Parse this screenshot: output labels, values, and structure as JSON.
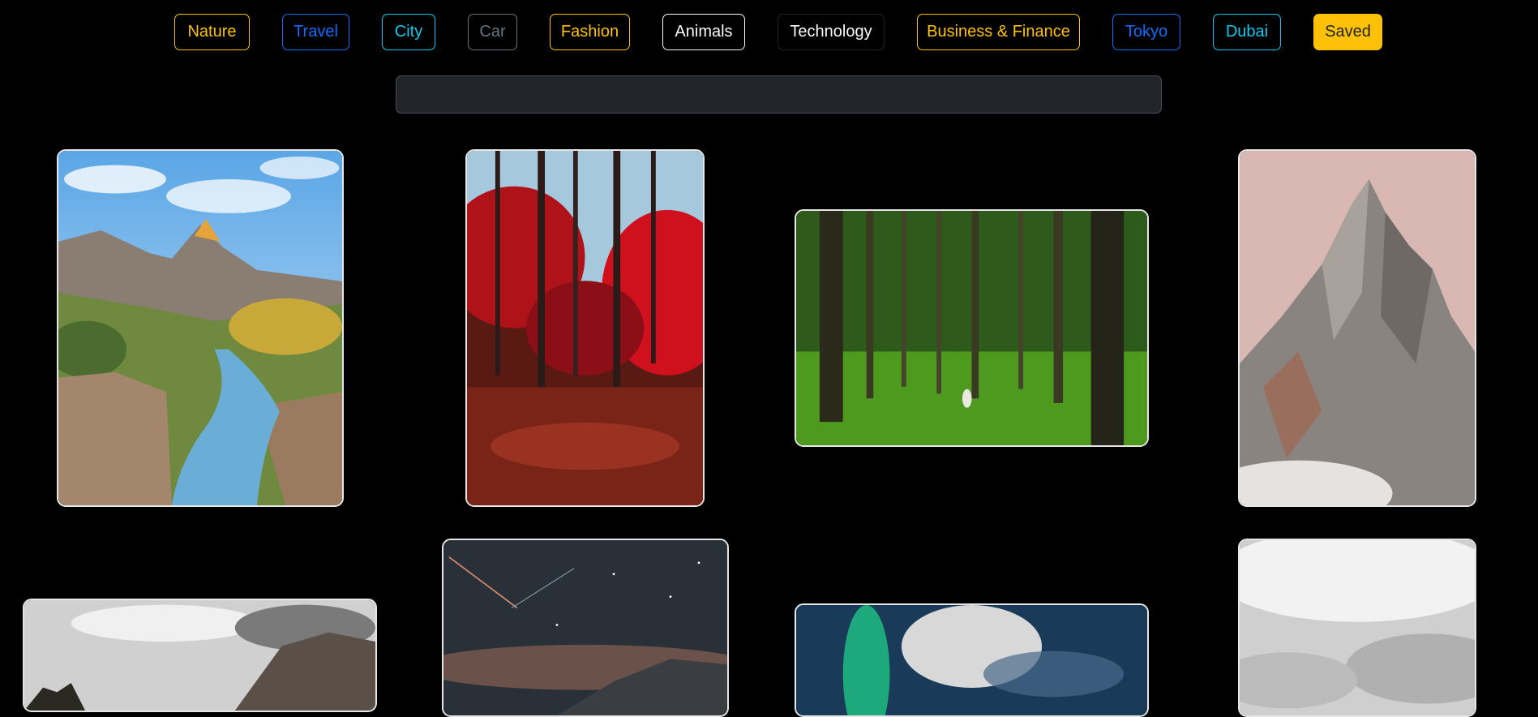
{
  "categories": [
    {
      "label": "Nature",
      "color": "#ffc107"
    },
    {
      "label": "Travel",
      "color": "#0d6efd"
    },
    {
      "label": "City",
      "color": "#0dcaf0"
    },
    {
      "label": "Car",
      "color": "#6c757d"
    },
    {
      "label": "Fashion",
      "color": "#ffc107"
    },
    {
      "label": "Animals",
      "color": "#f8f9fa"
    },
    {
      "label": "Technology",
      "color": "#212529"
    },
    {
      "label": "Business & Finance",
      "color": "#ffc107"
    },
    {
      "label": "Tokyo",
      "color": "#0d6efd"
    },
    {
      "label": "Dubai",
      "color": "#0dcaf0"
    }
  ],
  "saved": {
    "label": "Saved",
    "color": "#ffc107"
  },
  "search": {
    "value": "",
    "placeholder": ""
  },
  "gallery": [
    {
      "subject": "canyon river"
    },
    {
      "subject": "red autumn forest"
    },
    {
      "subject": "green pine forest"
    },
    {
      "subject": "rocky mountain peak"
    },
    {
      "subject": "mountain valley"
    },
    {
      "subject": "night sky meteor"
    },
    {
      "subject": "aurora clouds"
    },
    {
      "subject": "foggy grey clouds"
    }
  ]
}
